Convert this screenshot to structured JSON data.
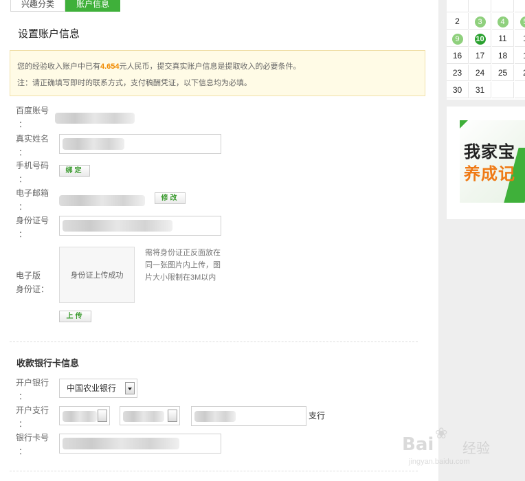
{
  "tabs": [
    {
      "label": "兴趣分类",
      "active": false
    },
    {
      "label": "账户信息",
      "active": true
    }
  ],
  "page_title": "设置账户信息",
  "notice": {
    "line1_prefix": "您的经验收入账户中已有",
    "amount": "4.654",
    "line1_suffix": "元人民币，提交真实账户信息是提取收入的必要条件。",
    "line2": "注：请正确填写即时的联系方式，支付稿酬凭证，以下信息均为必填。"
  },
  "fields": {
    "baidu_account": {
      "label": "百度账号",
      "colon": "："
    },
    "real_name": {
      "label": "真实姓名",
      "colon": "："
    },
    "phone": {
      "label": "手机号码",
      "colon": "：",
      "button": "绑定"
    },
    "email": {
      "label": "电子邮箱",
      "colon": "：",
      "button": "修改"
    },
    "id_number": {
      "label": "身份证号",
      "colon": "："
    },
    "id_card": {
      "label_line1": "电子版",
      "label_line2": "身份证：",
      "upload_status": "身份证上传成功",
      "hint": "需将身份证正反面放在同一张图片内上传，图片大小限制在3M以内",
      "upload_button": "上传"
    }
  },
  "bank": {
    "section_title": "收款银行卡信息",
    "bank_label": "开户银行",
    "bank_colon": "：",
    "bank_selected": "中国农业银行",
    "branch_label": "开户支行",
    "branch_colon": "：",
    "branch_suffix": "支行",
    "card_label": "银行卡号",
    "card_colon": "："
  },
  "calendar": {
    "rows": [
      [
        "",
        "",
        "",
        ""
      ],
      [
        "2",
        "3",
        "4",
        "5"
      ],
      [
        "9",
        "10",
        "11",
        "1"
      ],
      [
        "16",
        "17",
        "18",
        "1"
      ],
      [
        "23",
        "24",
        "25",
        "2"
      ],
      [
        "30",
        "31",
        "",
        ""
      ]
    ],
    "highlight_light": [
      "3",
      "4",
      "5",
      "9"
    ],
    "highlight_dark": [
      "10"
    ]
  },
  "ad": {
    "line1": "我家宝",
    "line2": "养成记"
  },
  "watermark": {
    "logo": "Bai",
    "paw": "❀",
    "text": "经验",
    "url": "jingyan.baidu.com"
  },
  "colors": {
    "accent": "#3fb03a",
    "amount": "#f08a00"
  }
}
